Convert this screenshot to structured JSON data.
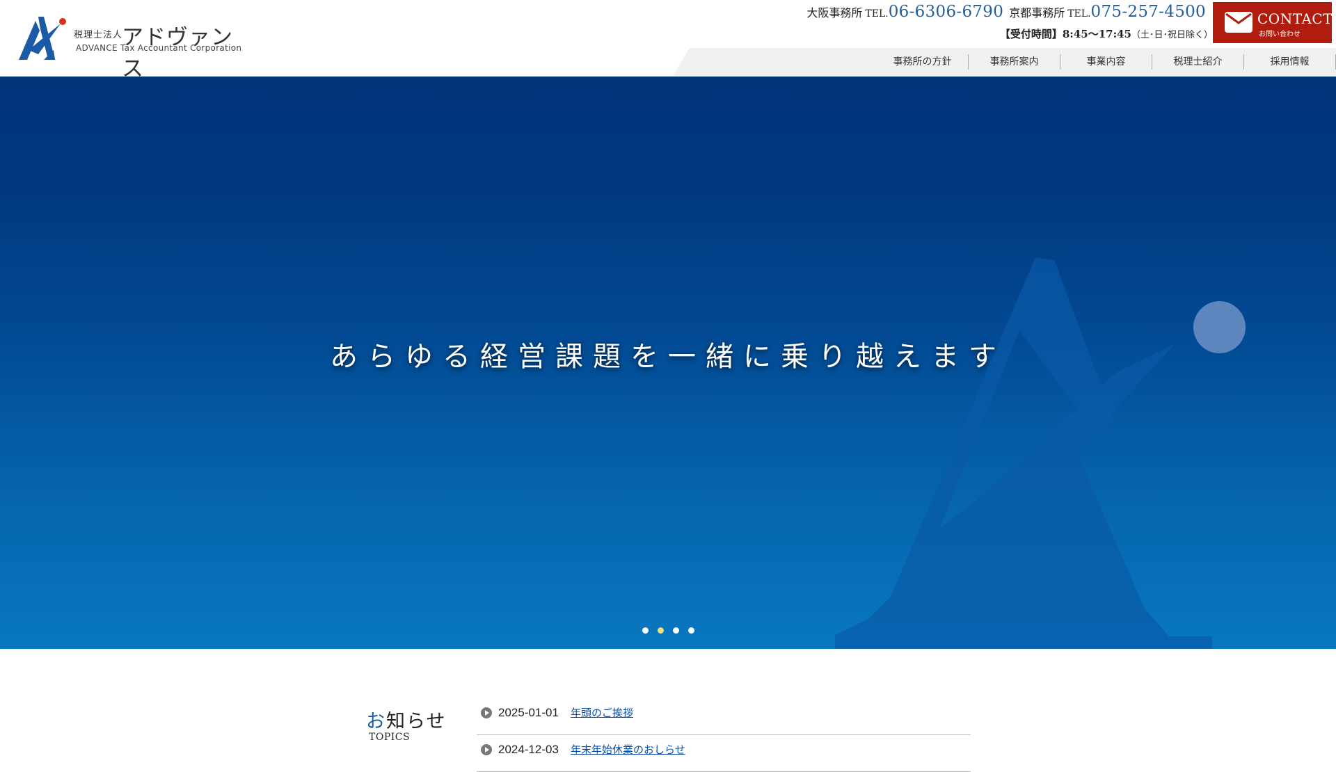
{
  "header": {
    "logo": {
      "prefix": "税理士法人",
      "name": "アドヴァンス",
      "english": "ADVANCE Tax Accountant Corporation"
    },
    "offices": [
      {
        "label": "大阪事務所",
        "tel_label": "TEL.",
        "tel": "06-6306-6790"
      },
      {
        "label": "京都事務所",
        "tel_label": "TEL.",
        "tel": "075-257-4500"
      }
    ],
    "hours": {
      "label": "【受付時間】",
      "time": "8:45〜17:45",
      "note": "（土･日･祝日除く）"
    },
    "contact": {
      "en": "CONTACT",
      "ja": "お問い合わせ"
    },
    "nav": [
      "事務所の方針",
      "事務所案内",
      "事業内容",
      "税理士紹介",
      "採用情報"
    ]
  },
  "hero": {
    "catchphrase": "あらゆる経営課題を一緒に乗り越えます",
    "slides": 4,
    "active_slide": 2
  },
  "topics": {
    "title_accent": "お",
    "title_rest": "知らせ",
    "title_en": "TOPICS",
    "items": [
      {
        "date": "2025-01-01",
        "title": "年頭のご挨拶"
      },
      {
        "date": "2024-12-03",
        "title": "年末年始休業のおしらせ"
      }
    ]
  },
  "colors": {
    "brand_blue": "#1f5f9f",
    "contact_red": "#b01c0e",
    "hero_top": "#02347a",
    "hero_bottom": "#0878c0",
    "active_dot": "#f2e17a"
  },
  "icons": [
    "logo-mark-icon",
    "envelope-icon",
    "play-circle-icon"
  ]
}
